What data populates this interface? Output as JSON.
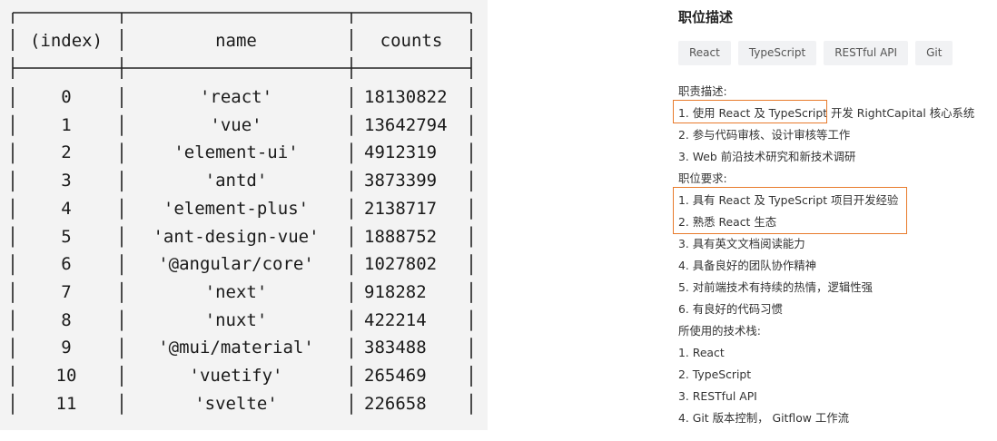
{
  "console_table": {
    "headers": {
      "index": "(index)",
      "name": "name",
      "counts": "counts"
    },
    "rows": [
      {
        "index": "0",
        "name": "'react'",
        "counts": "18130822"
      },
      {
        "index": "1",
        "name": "'vue'",
        "counts": "13642794"
      },
      {
        "index": "2",
        "name": "'element-ui'",
        "counts": "4912319"
      },
      {
        "index": "3",
        "name": "'antd'",
        "counts": "3873399"
      },
      {
        "index": "4",
        "name": "'element-plus'",
        "counts": "2138717"
      },
      {
        "index": "5",
        "name": "'ant-design-vue'",
        "counts": "1888752"
      },
      {
        "index": "6",
        "name": "'@angular/core'",
        "counts": "1027802"
      },
      {
        "index": "7",
        "name": "'next'",
        "counts": "918282"
      },
      {
        "index": "8",
        "name": "'nuxt'",
        "counts": "422214"
      },
      {
        "index": "9",
        "name": "'@mui/material'",
        "counts": "383488"
      },
      {
        "index": "10",
        "name": "'vuetify'",
        "counts": "265469"
      },
      {
        "index": "11",
        "name": "'svelte'",
        "counts": "226658"
      }
    ]
  },
  "job": {
    "title": "职位描述",
    "tags": [
      "React",
      "TypeScript",
      "RESTful API",
      "Git"
    ],
    "lines": [
      "职责描述:",
      "1. 使用 React 及 TypeScript 开发 RightCapital 核心系统",
      "2. 参与代码审核、设计审核等工作",
      "3. Web 前沿技术研究和新技术调研",
      "职位要求:",
      "1. 具有 React 及 TypeScript 项目开发经验",
      "2. 熟悉 React 生态",
      "3. 具有英文文档阅读能力",
      "4. 具备良好的团队协作精神",
      "5. 对前端技术有持续的热情，逻辑性强",
      "6. 有良好的代码习惯",
      "所使用的技术栈:",
      "1. React",
      "2. TypeScript",
      "3. RESTful API",
      "4. Git 版本控制， Gitflow 工作流"
    ],
    "highlight_color": "#e87b2c"
  }
}
